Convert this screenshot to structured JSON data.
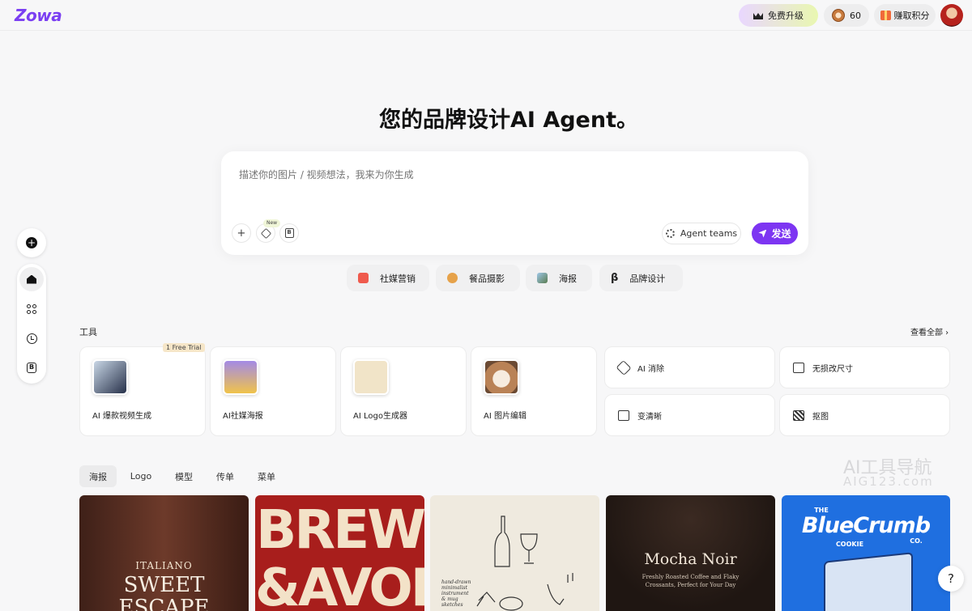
{
  "header": {
    "logo": "Zowa",
    "upgrade_label": "免费升级",
    "credits": "60",
    "earn_label": "赚取积分"
  },
  "hero": {
    "title": "您的品牌设计AI Agent。",
    "placeholder": "描述你的图片 / 视频想法，我来为你生成",
    "new_badge": "New",
    "agent_teams": "Agent teams",
    "send_label": "发送"
  },
  "chips": [
    "社媒营销",
    "餐品摄影",
    "海报",
    "品牌设计"
  ],
  "tools": {
    "section_label": "工具",
    "see_all": "查看全部 ›",
    "trial_badge": "1 Free Trial",
    "cards": [
      "AI 爆款视频生成",
      "AI社媒海报",
      "AI Logo生成器",
      "AI 图片编辑"
    ],
    "mini": [
      "AI 消除",
      "无损改尺寸",
      "变清晰",
      "抠图"
    ]
  },
  "tabs": [
    "海报",
    "Logo",
    "模型",
    "传单",
    "菜单"
  ],
  "gallery": {
    "card1": {
      "line1": "ITALIANO",
      "line2": "SWEET",
      "line3": "ESCAPE"
    },
    "card2": {
      "line1": "BREW",
      "line2": "&AVOR"
    },
    "card3": {
      "note": "hand-drawn minimalist instrument & mug sketches"
    },
    "card4": {
      "title": "Mocha Noir",
      "sub": "Freshly Roasted Coffee and Flaky Crossants, Perfect for Your Day"
    },
    "card5": {
      "small": "THE",
      "title": "BlueCrumb",
      "tag": "COOKIE",
      "co": "CO."
    }
  },
  "watermark": {
    "title": "AI工具导航",
    "sub": "AIG123.com"
  },
  "help": "?"
}
